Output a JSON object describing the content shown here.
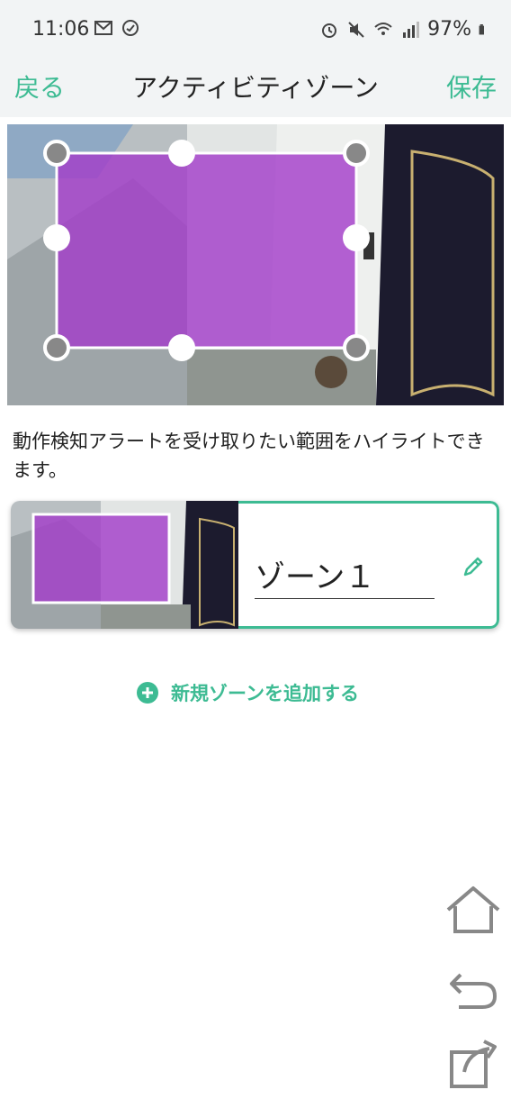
{
  "status_bar": {
    "time": "11:06",
    "battery": "97%",
    "icons": [
      "gmail-icon",
      "sync-icon",
      "alarm-icon",
      "mute-icon",
      "wifi-icon",
      "signal-icon",
      "battery-icon"
    ]
  },
  "header": {
    "back_label": "戻る",
    "title": "アクティビティゾーン",
    "save_label": "保存"
  },
  "camera_view": {
    "zone_color": "#a23bc9"
  },
  "hint_text": "動作検知アラートを受け取りたい範囲をハイライトできます。",
  "zones": [
    {
      "name": "ゾーン１",
      "edit_icon": "pencil-icon"
    }
  ],
  "add_zone": {
    "label": "新規ゾーンを追加する",
    "icon": "plus-circle-icon"
  },
  "side_nav": {
    "icons": [
      "home-icon",
      "undo-icon",
      "share-icon"
    ]
  },
  "colors": {
    "accent": "#3dbb93",
    "header_bg": "#f2f4f5"
  }
}
